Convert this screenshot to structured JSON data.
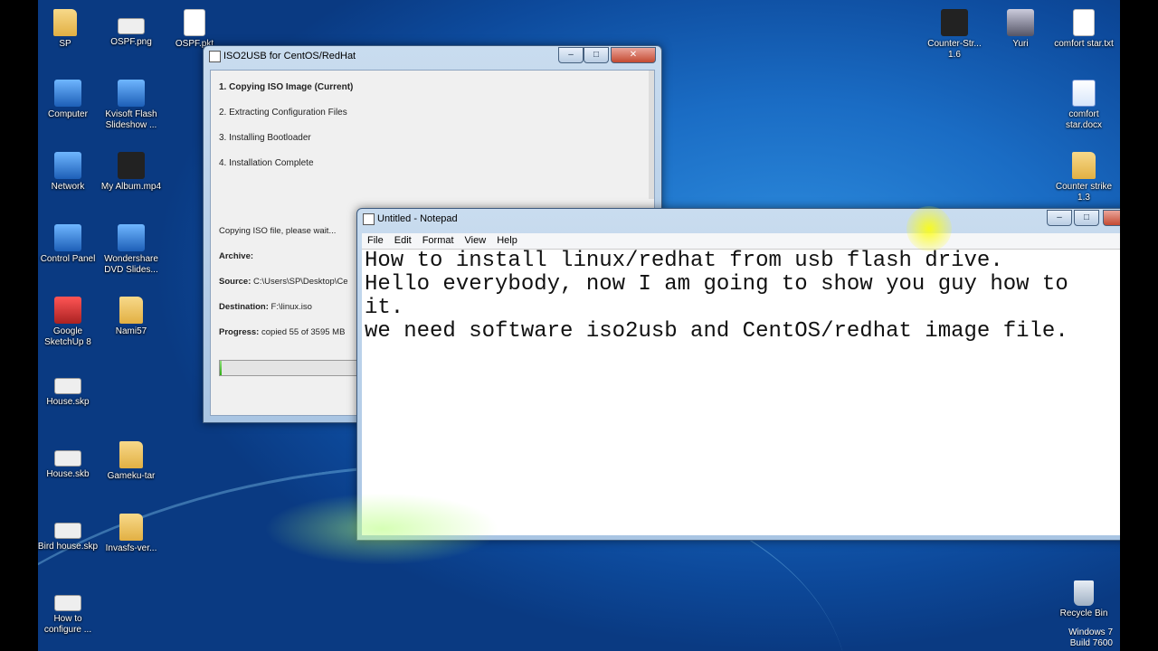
{
  "desktop_icons": [
    {
      "label": "SP",
      "icon": "folder-user-icon"
    },
    {
      "label": "OSPF.png",
      "icon": "image-icon"
    },
    {
      "label": "OSPF.pkt",
      "icon": "file-icon"
    },
    {
      "label": "Computer",
      "icon": "computer-icon"
    },
    {
      "label": "Kvisoft Flash Slideshow ...",
      "icon": "app-icon"
    },
    {
      "label": "Network",
      "icon": "network-icon"
    },
    {
      "label": "My Album.mp4",
      "icon": "video-icon"
    },
    {
      "label": "Control Panel",
      "icon": "control-panel-icon"
    },
    {
      "label": "Wondershare DVD Slides...",
      "icon": "app-icon"
    },
    {
      "label": "Google SketchUp 8",
      "icon": "sketchup-icon"
    },
    {
      "label": "Nami57",
      "icon": "folder-icon"
    },
    {
      "label": "House.skp",
      "icon": "skp-file-icon"
    },
    {
      "label": "House.skb",
      "icon": "skb-file-icon"
    },
    {
      "label": "Gameku-tar",
      "icon": "folder-icon"
    },
    {
      "label": "Bird house.skp",
      "icon": "skp-file-icon"
    },
    {
      "label": "Invasfs-ver...",
      "icon": "folder-icon"
    },
    {
      "label": "How to configure ...",
      "icon": "file-icon"
    },
    {
      "label": "Counter-Str... 1.6",
      "icon": "counter-strike-icon"
    },
    {
      "label": "Yuri",
      "icon": "yuri-icon"
    },
    {
      "label": "comfort star.txt",
      "icon": "text-file-icon"
    },
    {
      "label": "comfort star.docx",
      "icon": "word-file-icon"
    },
    {
      "label": "Counter strike 1.3",
      "icon": "folder-icon"
    },
    {
      "label": "Recycle Bin",
      "icon": "recycle-bin-icon"
    }
  ],
  "watermark": {
    "line1": "Windows 7",
    "line2": "Build 7600"
  },
  "iso_window": {
    "title": "ISO2USB for CentOS/RedHat",
    "steps": [
      "1. Copying ISO Image (Current)",
      "2. Extracting Configuration Files",
      "3. Installing Bootloader",
      "4. Installation Complete"
    ],
    "status": "Copying ISO file, please wait...",
    "archive_label": "Archive:",
    "source_label": "Source:",
    "source_value": "C:\\Users\\SP\\Desktop\\Ce",
    "destination_label": "Destination:",
    "destination_value": "F:\\linux.iso",
    "progress_label": "Progress:",
    "progress_value": "copied 55 of 3595 MB",
    "progress_fraction": 0.015
  },
  "notepad": {
    "title": "Untitled - Notepad",
    "menu": [
      "File",
      "Edit",
      "Format",
      "View",
      "Help"
    ],
    "lines": [
      "How to install linux/redhat from usb flash drive.",
      "",
      "Hello everybody, now I am going to show you guy how to",
      "it.",
      "",
      "we need software iso2usb and CentOS/redhat image file."
    ]
  }
}
